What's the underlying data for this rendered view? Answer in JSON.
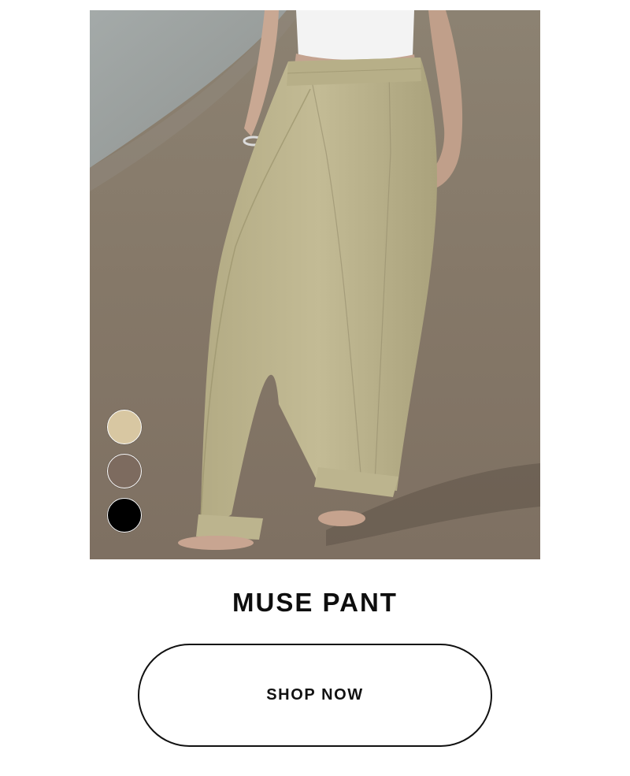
{
  "product": {
    "title": "MUSE PANT",
    "image_alt": "Model wearing wide-leg khaki pleated trousers on a beach"
  },
  "swatches": [
    {
      "name": "khaki",
      "color": "#d8c7a2"
    },
    {
      "name": "taupe",
      "color": "#7d6b5f"
    },
    {
      "name": "black",
      "color": "#000000"
    }
  ],
  "cta": {
    "label": "SHOP NOW"
  },
  "colors": {
    "sand": "#8a7d6f",
    "sea": "#9aa0a0",
    "pant": "#bdb58e",
    "shirt": "#f2f2f2"
  }
}
